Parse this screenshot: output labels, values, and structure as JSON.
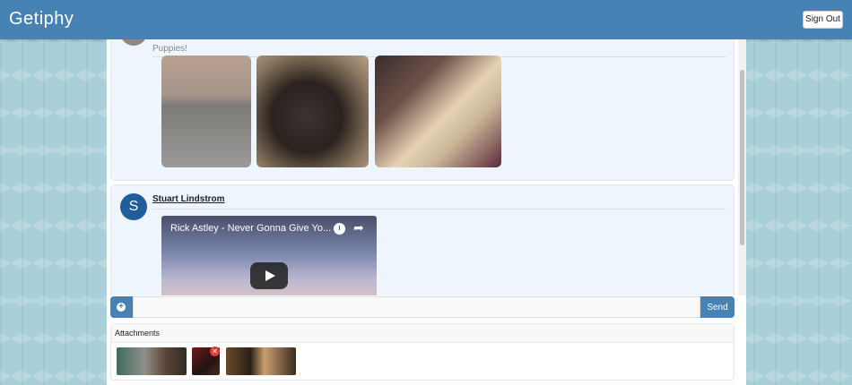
{
  "app": {
    "brand": "Getiphy",
    "signout_label": "Sign Out"
  },
  "feed": {
    "messages": [
      {
        "text": "Puppies!",
        "gifs": [
          "dog-on-bicycle-gif",
          "puppy-gif",
          "labrador-puppies-gif"
        ]
      },
      {
        "author": "Stuart Lindstrom",
        "avatar_letter": "S",
        "video_title": "Rick Astley - Never Gonna Give Yo..."
      }
    ]
  },
  "composer": {
    "placeholder": "",
    "send_label": "Send",
    "attach_icon": "plus-circle-icon"
  },
  "attachments": {
    "title": "Attachments",
    "remove_icon": "close-icon"
  },
  "colors": {
    "primary": "#4682b4",
    "card_bg": "#eef5fd",
    "avatar": "#1f5d9b",
    "danger": "#e53935"
  }
}
